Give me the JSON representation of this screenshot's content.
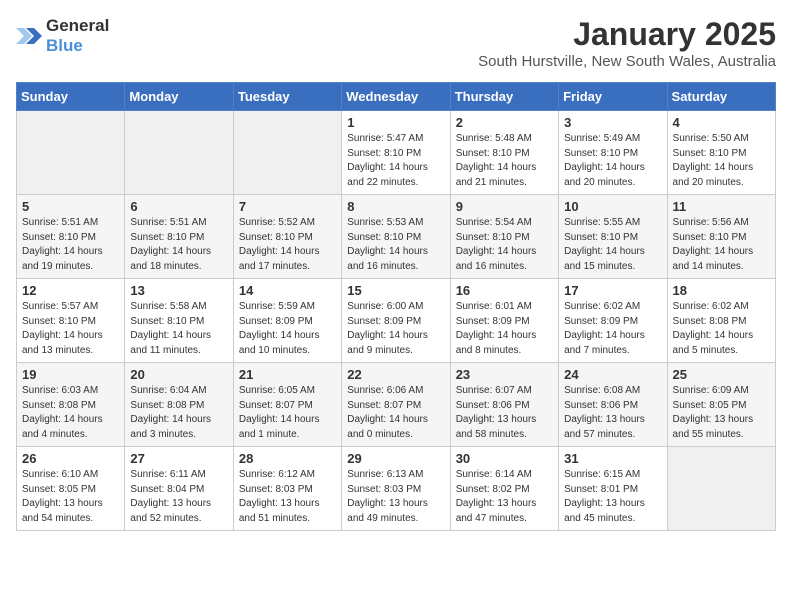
{
  "logo": {
    "general": "General",
    "blue": "Blue"
  },
  "header": {
    "month": "January 2025",
    "location": "South Hurstville, New South Wales, Australia"
  },
  "weekdays": [
    "Sunday",
    "Monday",
    "Tuesday",
    "Wednesday",
    "Thursday",
    "Friday",
    "Saturday"
  ],
  "weeks": [
    [
      {
        "day": "",
        "info": ""
      },
      {
        "day": "",
        "info": ""
      },
      {
        "day": "",
        "info": ""
      },
      {
        "day": "1",
        "info": "Sunrise: 5:47 AM\nSunset: 8:10 PM\nDaylight: 14 hours\nand 22 minutes."
      },
      {
        "day": "2",
        "info": "Sunrise: 5:48 AM\nSunset: 8:10 PM\nDaylight: 14 hours\nand 21 minutes."
      },
      {
        "day": "3",
        "info": "Sunrise: 5:49 AM\nSunset: 8:10 PM\nDaylight: 14 hours\nand 20 minutes."
      },
      {
        "day": "4",
        "info": "Sunrise: 5:50 AM\nSunset: 8:10 PM\nDaylight: 14 hours\nand 20 minutes."
      }
    ],
    [
      {
        "day": "5",
        "info": "Sunrise: 5:51 AM\nSunset: 8:10 PM\nDaylight: 14 hours\nand 19 minutes."
      },
      {
        "day": "6",
        "info": "Sunrise: 5:51 AM\nSunset: 8:10 PM\nDaylight: 14 hours\nand 18 minutes."
      },
      {
        "day": "7",
        "info": "Sunrise: 5:52 AM\nSunset: 8:10 PM\nDaylight: 14 hours\nand 17 minutes."
      },
      {
        "day": "8",
        "info": "Sunrise: 5:53 AM\nSunset: 8:10 PM\nDaylight: 14 hours\nand 16 minutes."
      },
      {
        "day": "9",
        "info": "Sunrise: 5:54 AM\nSunset: 8:10 PM\nDaylight: 14 hours\nand 16 minutes."
      },
      {
        "day": "10",
        "info": "Sunrise: 5:55 AM\nSunset: 8:10 PM\nDaylight: 14 hours\nand 15 minutes."
      },
      {
        "day": "11",
        "info": "Sunrise: 5:56 AM\nSunset: 8:10 PM\nDaylight: 14 hours\nand 14 minutes."
      }
    ],
    [
      {
        "day": "12",
        "info": "Sunrise: 5:57 AM\nSunset: 8:10 PM\nDaylight: 14 hours\nand 13 minutes."
      },
      {
        "day": "13",
        "info": "Sunrise: 5:58 AM\nSunset: 8:10 PM\nDaylight: 14 hours\nand 11 minutes."
      },
      {
        "day": "14",
        "info": "Sunrise: 5:59 AM\nSunset: 8:09 PM\nDaylight: 14 hours\nand 10 minutes."
      },
      {
        "day": "15",
        "info": "Sunrise: 6:00 AM\nSunset: 8:09 PM\nDaylight: 14 hours\nand 9 minutes."
      },
      {
        "day": "16",
        "info": "Sunrise: 6:01 AM\nSunset: 8:09 PM\nDaylight: 14 hours\nand 8 minutes."
      },
      {
        "day": "17",
        "info": "Sunrise: 6:02 AM\nSunset: 8:09 PM\nDaylight: 14 hours\nand 7 minutes."
      },
      {
        "day": "18",
        "info": "Sunrise: 6:02 AM\nSunset: 8:08 PM\nDaylight: 14 hours\nand 5 minutes."
      }
    ],
    [
      {
        "day": "19",
        "info": "Sunrise: 6:03 AM\nSunset: 8:08 PM\nDaylight: 14 hours\nand 4 minutes."
      },
      {
        "day": "20",
        "info": "Sunrise: 6:04 AM\nSunset: 8:08 PM\nDaylight: 14 hours\nand 3 minutes."
      },
      {
        "day": "21",
        "info": "Sunrise: 6:05 AM\nSunset: 8:07 PM\nDaylight: 14 hours\nand 1 minute."
      },
      {
        "day": "22",
        "info": "Sunrise: 6:06 AM\nSunset: 8:07 PM\nDaylight: 14 hours\nand 0 minutes."
      },
      {
        "day": "23",
        "info": "Sunrise: 6:07 AM\nSunset: 8:06 PM\nDaylight: 13 hours\nand 58 minutes."
      },
      {
        "day": "24",
        "info": "Sunrise: 6:08 AM\nSunset: 8:06 PM\nDaylight: 13 hours\nand 57 minutes."
      },
      {
        "day": "25",
        "info": "Sunrise: 6:09 AM\nSunset: 8:05 PM\nDaylight: 13 hours\nand 55 minutes."
      }
    ],
    [
      {
        "day": "26",
        "info": "Sunrise: 6:10 AM\nSunset: 8:05 PM\nDaylight: 13 hours\nand 54 minutes."
      },
      {
        "day": "27",
        "info": "Sunrise: 6:11 AM\nSunset: 8:04 PM\nDaylight: 13 hours\nand 52 minutes."
      },
      {
        "day": "28",
        "info": "Sunrise: 6:12 AM\nSunset: 8:03 PM\nDaylight: 13 hours\nand 51 minutes."
      },
      {
        "day": "29",
        "info": "Sunrise: 6:13 AM\nSunset: 8:03 PM\nDaylight: 13 hours\nand 49 minutes."
      },
      {
        "day": "30",
        "info": "Sunrise: 6:14 AM\nSunset: 8:02 PM\nDaylight: 13 hours\nand 47 minutes."
      },
      {
        "day": "31",
        "info": "Sunrise: 6:15 AM\nSunset: 8:01 PM\nDaylight: 13 hours\nand 45 minutes."
      },
      {
        "day": "",
        "info": ""
      }
    ]
  ]
}
